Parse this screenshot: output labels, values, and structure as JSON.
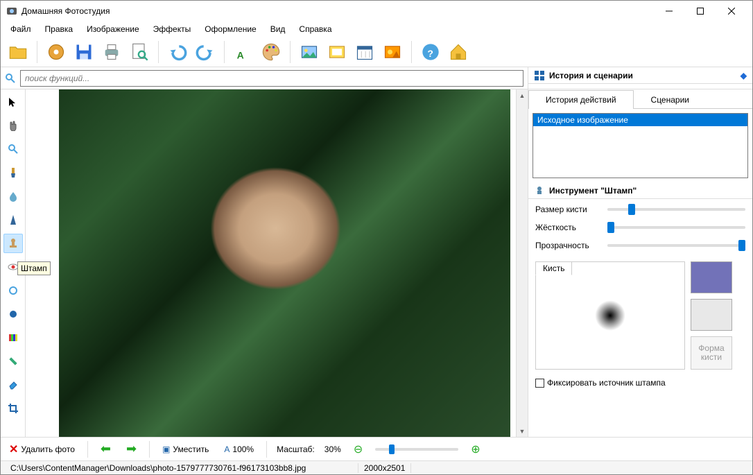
{
  "app": {
    "title": "Домашняя Фотостудия"
  },
  "menu": [
    "Файл",
    "Правка",
    "Изображение",
    "Эффекты",
    "Оформление",
    "Вид",
    "Справка"
  ],
  "toolbar_icons": [
    "open-folder-icon",
    "batch-icon",
    "save-icon",
    "print-icon",
    "page-preview-icon",
    "undo-icon",
    "redo-icon",
    "text-icon",
    "palette-icon",
    "image-icon",
    "frame-icon",
    "calendar-icon",
    "effects-icon",
    "help-icon",
    "home-icon"
  ],
  "search": {
    "placeholder": "поиск функций..."
  },
  "tooltip": "Штамп",
  "left_tools": [
    "pointer-icon",
    "hand-icon",
    "zoom-icon",
    "brush-icon",
    "blur-icon",
    "sharpen-icon",
    "stamp-icon",
    "redeye-icon",
    "dodge-icon",
    "burn-icon",
    "gradient-icon",
    "healing-icon",
    "eraser-icon",
    "crop-icon"
  ],
  "left_tool_active_index": 6,
  "right": {
    "history_title": "История и сценарии",
    "tabs": [
      "История действий",
      "Сценарии"
    ],
    "active_tab": 0,
    "history_items": [
      "Исходное изображение"
    ],
    "tool_title": "Инструмент \"Штамп\"",
    "props": {
      "size_label": "Размер кисти",
      "size_pct": 15,
      "hard_label": "Жёсткость",
      "hard_pct": 0,
      "opac_label": "Прозрачность",
      "opac_pct": 100
    },
    "brush_tab": "Кисть",
    "shape_btn": "Форма кисти",
    "fix_label": "Фиксировать источник штампа"
  },
  "bottom": {
    "delete": "Удалить фото",
    "fit": "Уместить",
    "hundred": "100%",
    "scale_label": "Масштаб:",
    "scale_value": "30%"
  },
  "status": {
    "path": "C:\\Users\\ContentManager\\Downloads\\photo-1579777730761-f96173103bb8.jpg",
    "dims": "2000x2501"
  }
}
